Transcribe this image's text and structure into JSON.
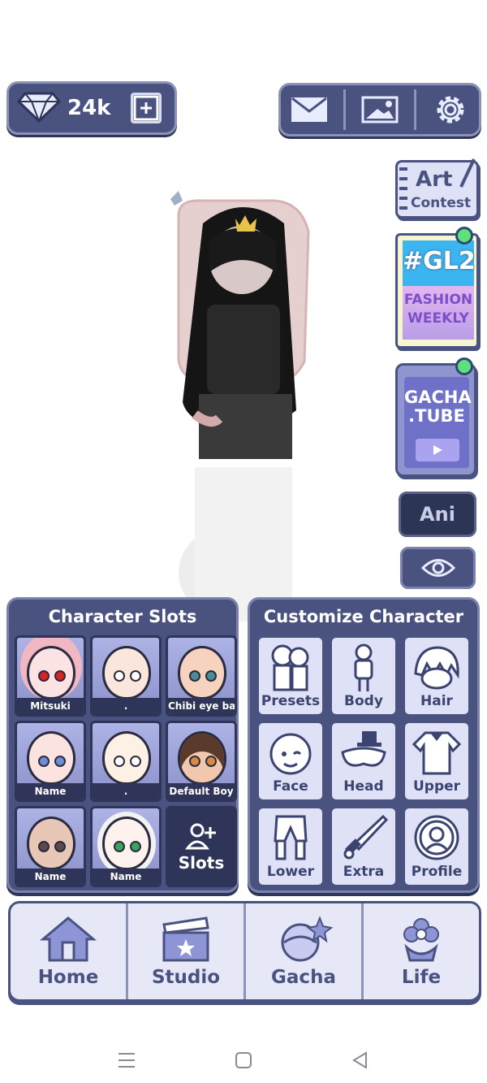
{
  "currency": {
    "amount": "24k"
  },
  "side": {
    "art_contest": {
      "line1": "Art",
      "line2": "Contest"
    },
    "gl2": {
      "tag": "#GL2",
      "line1": "FASHION",
      "line2": "WEEKLY"
    },
    "gacha_tube": {
      "line1": "GACHA",
      "line2": ".TUBE"
    },
    "ani_label": "Ani"
  },
  "character_slots": {
    "title": "Character Slots",
    "slots": [
      {
        "name": "Mitsuki"
      },
      {
        "name": "."
      },
      {
        "name": "Chibi eye base"
      },
      {
        "name": "Name"
      },
      {
        "name": "."
      },
      {
        "name": "Default Boy"
      },
      {
        "name": "Name"
      },
      {
        "name": "Name"
      }
    ],
    "add_label": "Slots"
  },
  "customize": {
    "title": "Customize Character",
    "tiles": [
      {
        "label": "Presets"
      },
      {
        "label": "Body"
      },
      {
        "label": "Hair"
      },
      {
        "label": "Face"
      },
      {
        "label": "Head"
      },
      {
        "label": "Upper"
      },
      {
        "label": "Lower"
      },
      {
        "label": "Extra"
      },
      {
        "label": "Profile"
      }
    ]
  },
  "nav": {
    "items": [
      {
        "label": "Home"
      },
      {
        "label": "Studio"
      },
      {
        "label": "Gacha"
      },
      {
        "label": "Life"
      }
    ]
  },
  "colors": {
    "panel": "#4a5380",
    "accent": "#8d93b8",
    "tile": "#dfe2f7"
  }
}
